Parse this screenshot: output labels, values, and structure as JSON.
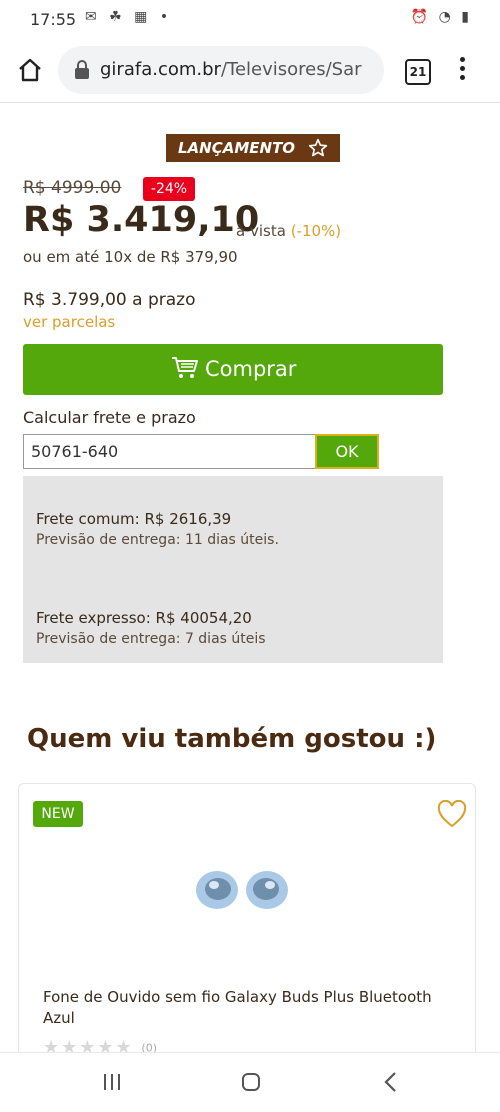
{
  "status_bar": {
    "time": "17:55",
    "left_icons": "✉ ☘ ▦ •",
    "right_icons": "⏰ ◔ ▮"
  },
  "browser": {
    "url_host": "girafa.com.br",
    "url_path": "/Televisores/Sar",
    "tab_count": "21"
  },
  "product": {
    "launch_badge": "LANÇAMENTO",
    "old_price": "R$ 4999.00",
    "discount": "-24%",
    "price": "R$ 3.419,10",
    "price_suffix": "à vista",
    "price_discount": "(-10%)",
    "installments": "ou em até 10x de R$ 379,90",
    "term_price": "R$ 3.799,00 a prazo",
    "installments_link": "ver parcelas",
    "buy_label": "Comprar"
  },
  "shipping": {
    "title": "Calcular frete e prazo",
    "cep_value": "50761-640",
    "ok_label": "OK",
    "options": [
      {
        "title": "Frete comum: R$ 2616,39",
        "eta": "Previsão de entrega: 11 dias úteis."
      },
      {
        "title": "Frete expresso: R$ 40054,20",
        "eta": "Previsão de entrega: 7 dias úteis"
      }
    ]
  },
  "recommendations": {
    "title": "Quem viu também gostou :)",
    "items": [
      {
        "badge": "NEW",
        "name": "Fone de Ouvido sem fio Galaxy Buds Plus Bluetooth Azul",
        "rating_count": "(0)",
        "stars": 0
      }
    ]
  },
  "colors": {
    "brand_green": "#54a80c",
    "brand_brown": "#6a3812",
    "accent_gold": "#d9a02b",
    "discount_red": "#e8001c"
  }
}
